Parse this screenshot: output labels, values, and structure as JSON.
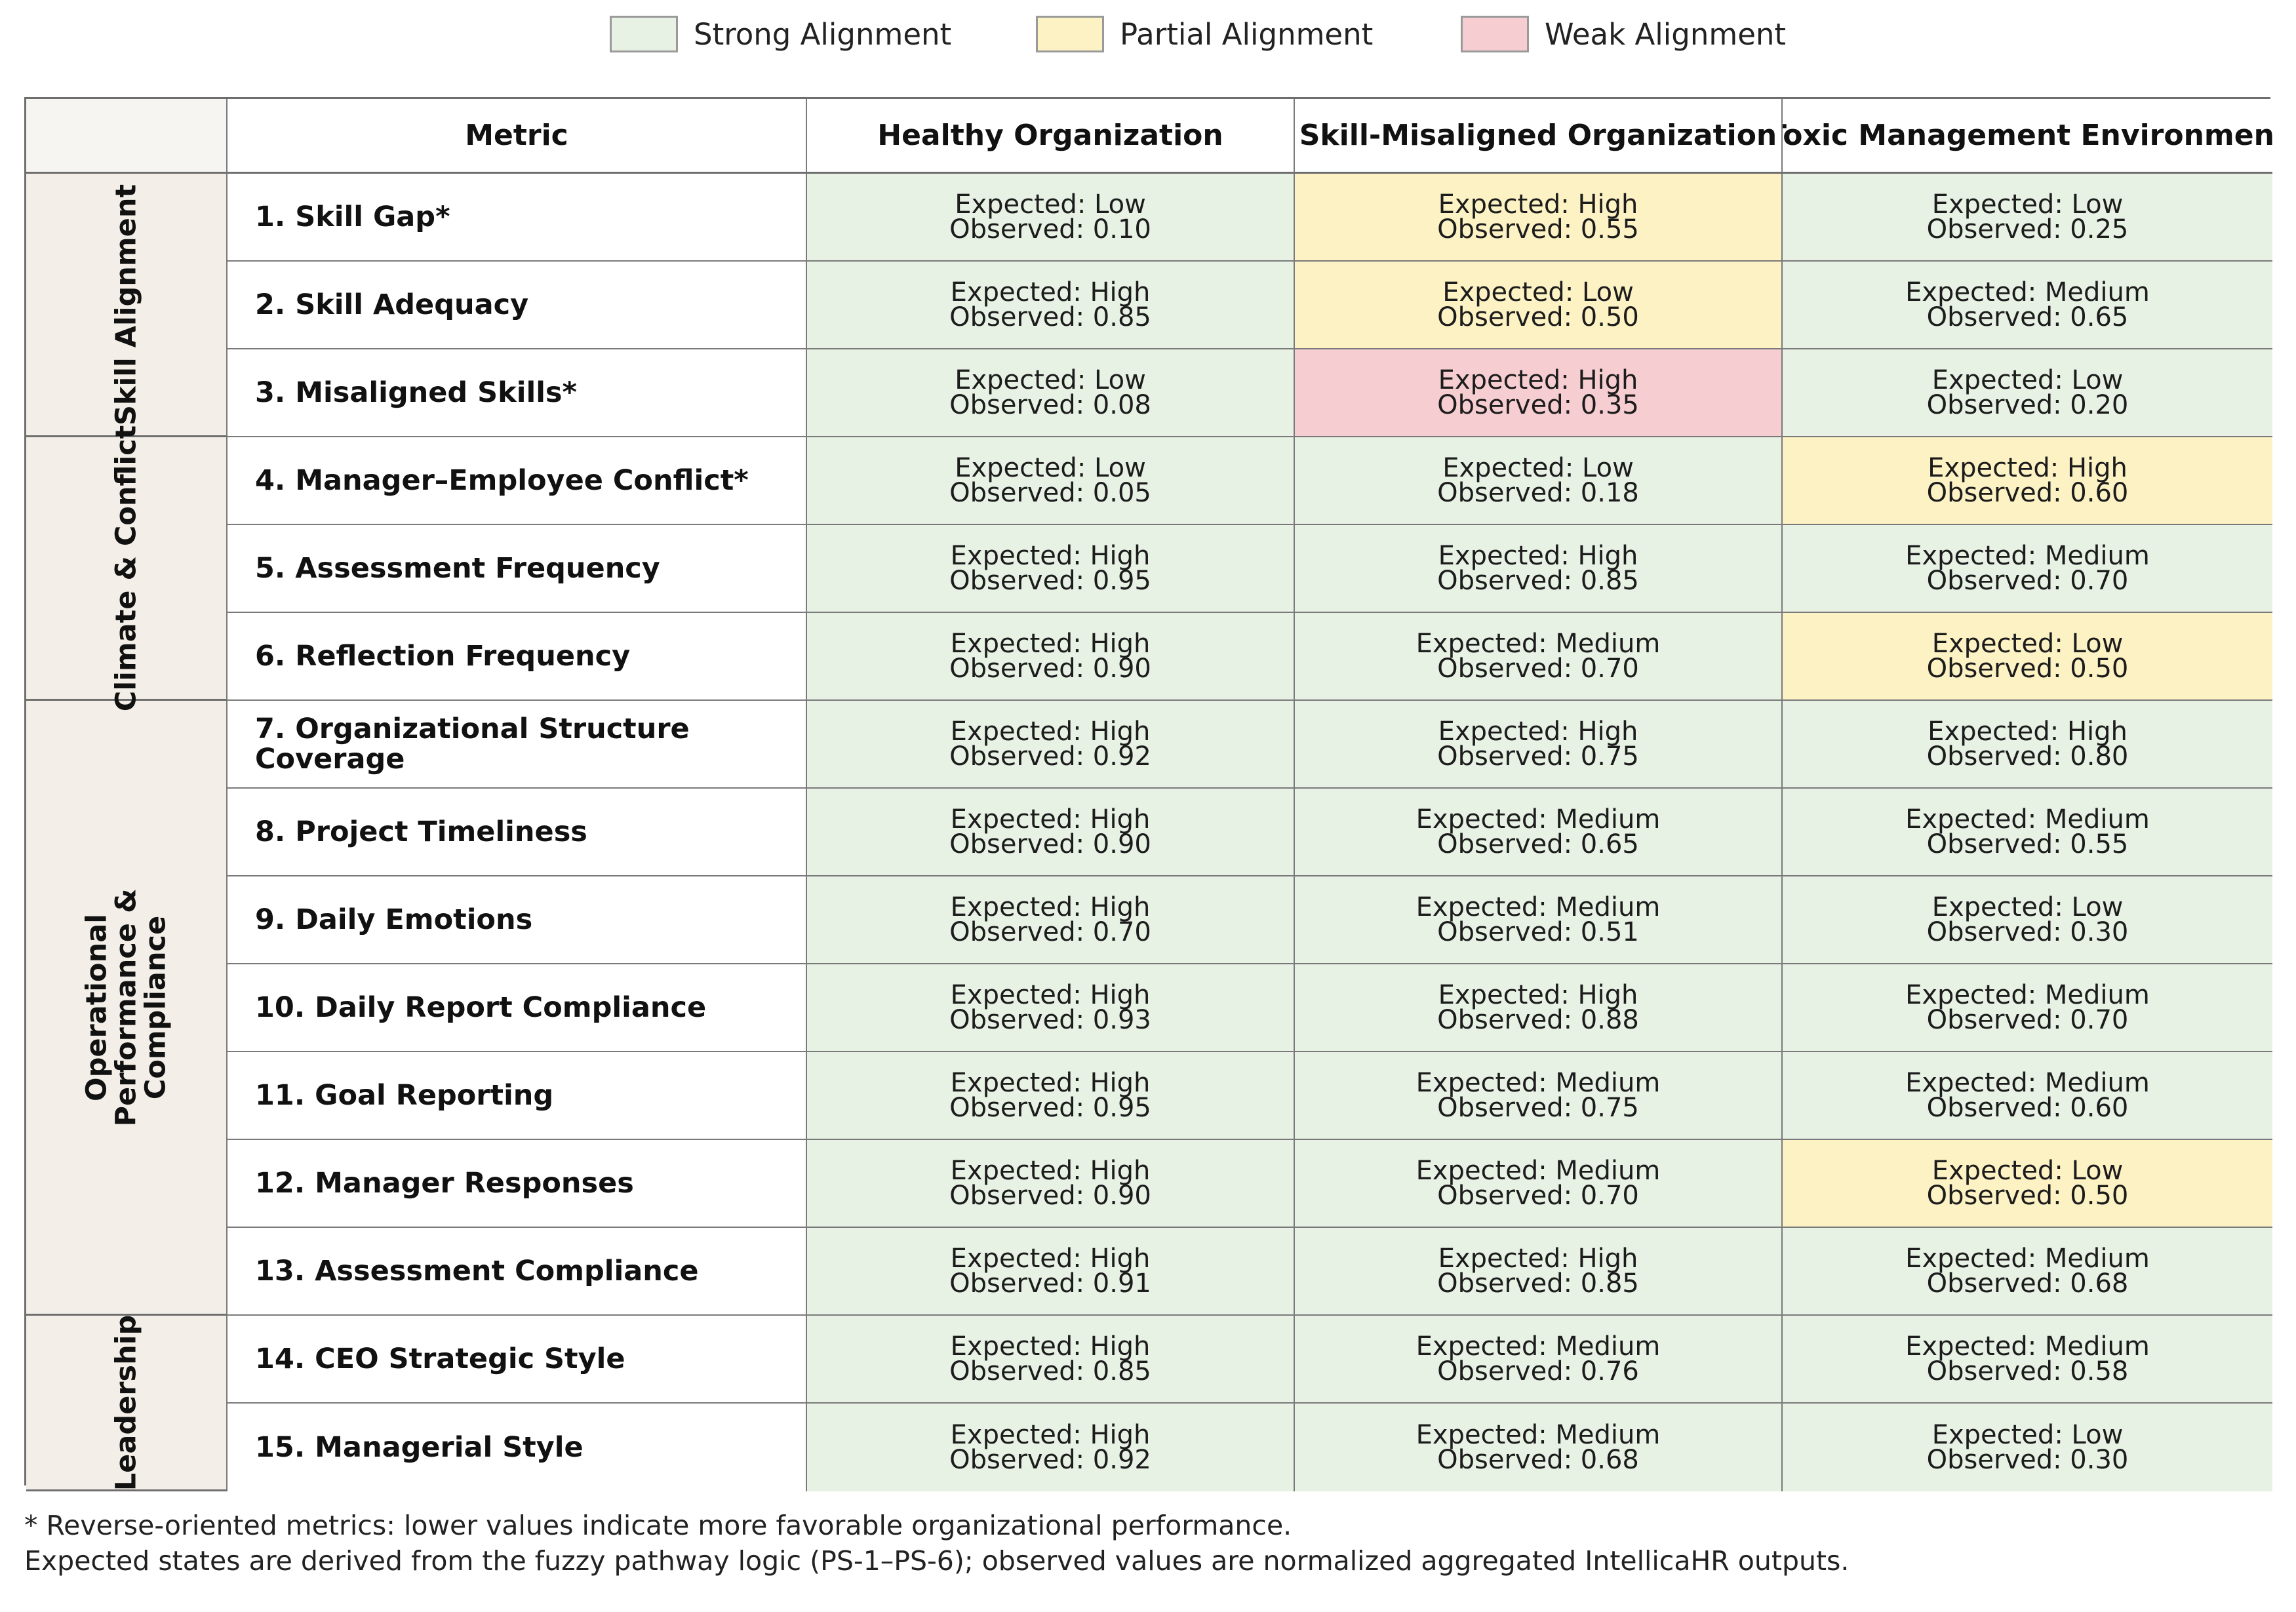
{
  "legend": [
    {
      "label": "Strong Alignment",
      "color": "#e7f1e4"
    },
    {
      "label": "Partial Alignment",
      "color": "#fdf2c4"
    },
    {
      "label": "Weak Alignment",
      "color": "#f6cdd0"
    }
  ],
  "chart_data": {
    "type": "table",
    "columns": [
      "Metric",
      "Healthy Organization",
      "Skill-Misaligned Organization",
      "Toxic Management Environment"
    ],
    "groups": [
      {
        "label": "Skill Alignment",
        "rows": [
          0,
          2
        ]
      },
      {
        "label": "Climate & Conflict",
        "rows": [
          3,
          5
        ]
      },
      {
        "label": "Operational Performance & Compliance",
        "rows": [
          6,
          12
        ]
      },
      {
        "label": "Leadership",
        "rows": [
          13,
          14
        ]
      }
    ],
    "rows": [
      {
        "metric": "1. Skill Gap*",
        "cells": [
          {
            "expected": "Expected: Low",
            "observed": "Observed: 0.10",
            "alignment": "strong"
          },
          {
            "expected": "Expected: High",
            "observed": "Observed: 0.55",
            "alignment": "partial"
          },
          {
            "expected": "Expected: Low",
            "observed": "Observed: 0.25",
            "alignment": "strong"
          }
        ]
      },
      {
        "metric": "2. Skill Adequacy",
        "cells": [
          {
            "expected": "Expected: High",
            "observed": "Observed: 0.85",
            "alignment": "strong"
          },
          {
            "expected": "Expected: Low",
            "observed": "Observed: 0.50",
            "alignment": "partial"
          },
          {
            "expected": "Expected: Medium",
            "observed": "Observed: 0.65",
            "alignment": "strong"
          }
        ]
      },
      {
        "metric": "3. Misaligned Skills*",
        "cells": [
          {
            "expected": "Expected: Low",
            "observed": "Observed: 0.08",
            "alignment": "strong"
          },
          {
            "expected": "Expected: High",
            "observed": "Observed: 0.35",
            "alignment": "weak"
          },
          {
            "expected": "Expected: Low",
            "observed": "Observed: 0.20",
            "alignment": "strong"
          }
        ]
      },
      {
        "metric": "4. Manager–Employee Conflict*",
        "cells": [
          {
            "expected": "Expected: Low",
            "observed": "Observed: 0.05",
            "alignment": "strong"
          },
          {
            "expected": "Expected: Low",
            "observed": "Observed: 0.18",
            "alignment": "strong"
          },
          {
            "expected": "Expected: High",
            "observed": "Observed: 0.60",
            "alignment": "partial"
          }
        ]
      },
      {
        "metric": "5. Assessment Frequency",
        "cells": [
          {
            "expected": "Expected: High",
            "observed": "Observed: 0.95",
            "alignment": "strong"
          },
          {
            "expected": "Expected: High",
            "observed": "Observed: 0.85",
            "alignment": "strong"
          },
          {
            "expected": "Expected: Medium",
            "observed": "Observed: 0.70",
            "alignment": "strong"
          }
        ]
      },
      {
        "metric": "6. Reflection Frequency",
        "cells": [
          {
            "expected": "Expected: High",
            "observed": "Observed: 0.90",
            "alignment": "strong"
          },
          {
            "expected": "Expected: Medium",
            "observed": "Observed: 0.70",
            "alignment": "strong"
          },
          {
            "expected": "Expected: Low",
            "observed": "Observed: 0.50",
            "alignment": "partial"
          }
        ]
      },
      {
        "metric": "7. Organizational Structure Coverage",
        "cells": [
          {
            "expected": "Expected: High",
            "observed": "Observed: 0.92",
            "alignment": "strong"
          },
          {
            "expected": "Expected: High",
            "observed": "Observed: 0.75",
            "alignment": "strong"
          },
          {
            "expected": "Expected: High",
            "observed": "Observed: 0.80",
            "alignment": "strong"
          }
        ]
      },
      {
        "metric": "8. Project Timeliness",
        "cells": [
          {
            "expected": "Expected: High",
            "observed": "Observed: 0.90",
            "alignment": "strong"
          },
          {
            "expected": "Expected: Medium",
            "observed": "Observed: 0.65",
            "alignment": "strong"
          },
          {
            "expected": "Expected: Medium",
            "observed": "Observed: 0.55",
            "alignment": "strong"
          }
        ]
      },
      {
        "metric": "9. Daily Emotions",
        "cells": [
          {
            "expected": "Expected: High",
            "observed": "Observed: 0.70",
            "alignment": "strong"
          },
          {
            "expected": "Expected: Medium",
            "observed": "Observed: 0.51",
            "alignment": "strong"
          },
          {
            "expected": "Expected: Low",
            "observed": "Observed: 0.30",
            "alignment": "strong"
          }
        ]
      },
      {
        "metric": "10. Daily Report Compliance",
        "cells": [
          {
            "expected": "Expected: High",
            "observed": "Observed: 0.93",
            "alignment": "strong"
          },
          {
            "expected": "Expected: High",
            "observed": "Observed: 0.88",
            "alignment": "strong"
          },
          {
            "expected": "Expected: Medium",
            "observed": "Observed: 0.70",
            "alignment": "strong"
          }
        ]
      },
      {
        "metric": "11. Goal Reporting",
        "cells": [
          {
            "expected": "Expected: High",
            "observed": "Observed: 0.95",
            "alignment": "strong"
          },
          {
            "expected": "Expected: Medium",
            "observed": "Observed: 0.75",
            "alignment": "strong"
          },
          {
            "expected": "Expected: Medium",
            "observed": "Observed: 0.60",
            "alignment": "strong"
          }
        ]
      },
      {
        "metric": "12. Manager Responses",
        "cells": [
          {
            "expected": "Expected: High",
            "observed": "Observed: 0.90",
            "alignment": "strong"
          },
          {
            "expected": "Expected: Medium",
            "observed": "Observed: 0.70",
            "alignment": "strong"
          },
          {
            "expected": "Expected: Low",
            "observed": "Observed: 0.50",
            "alignment": "partial"
          }
        ]
      },
      {
        "metric": "13. Assessment Compliance",
        "cells": [
          {
            "expected": "Expected: High",
            "observed": "Observed: 0.91",
            "alignment": "strong"
          },
          {
            "expected": "Expected: High",
            "observed": "Observed: 0.85",
            "alignment": "strong"
          },
          {
            "expected": "Expected: Medium",
            "observed": "Observed: 0.68",
            "alignment": "strong"
          }
        ]
      },
      {
        "metric": "14. CEO Strategic Style",
        "cells": [
          {
            "expected": "Expected: High",
            "observed": "Observed: 0.85",
            "alignment": "strong"
          },
          {
            "expected": "Expected: Medium",
            "observed": "Observed: 0.76",
            "alignment": "strong"
          },
          {
            "expected": "Expected: Medium",
            "observed": "Observed: 0.58",
            "alignment": "strong"
          }
        ]
      },
      {
        "metric": "15. Managerial Style",
        "cells": [
          {
            "expected": "Expected: High",
            "observed": "Observed: 0.92",
            "alignment": "strong"
          },
          {
            "expected": "Expected: Medium",
            "observed": "Observed: 0.68",
            "alignment": "strong"
          },
          {
            "expected": "Expected: Low",
            "observed": "Observed: 0.30",
            "alignment": "strong"
          }
        ]
      }
    ]
  },
  "footnotes": {
    "reverse": "* Reverse-oriented metrics: lower values indicate more favorable organizational performance.",
    "method": "Expected states are derived from the fuzzy pathway logic (PS-1–PS-6); observed values are normalized aggregated IntellicaHR outputs."
  }
}
